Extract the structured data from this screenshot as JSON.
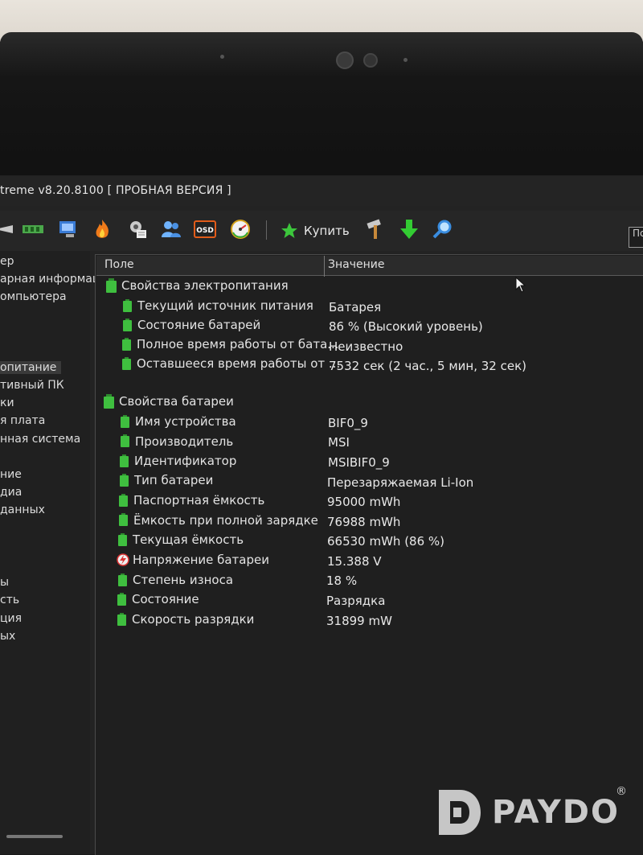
{
  "window": {
    "title": "treme v8.20.8100  [ ПРОБНАЯ ВЕРСИЯ ]"
  },
  "toolbar": {
    "buy_label": "Купить",
    "search_value": "Пс"
  },
  "tree": {
    "items": [
      "ер",
      "арная информац",
      "омпьютера",
      "",
      "",
      "",
      "опитание",
      "тивный ПК",
      "ки",
      "я плата",
      "нная система",
      "",
      "ние",
      "диа",
      "данных",
      "",
      "",
      "ы",
      "сть",
      "ция",
      "ых"
    ],
    "selected_index": 6
  },
  "grid": {
    "col_field": "Поле",
    "col_value": "Значение",
    "groups": [
      {
        "title": "Свойства электропитания",
        "rows": [
          {
            "label": "Текущий источник питания",
            "value": "Батарея"
          },
          {
            "label": "Состояние батарей",
            "value": "86 % (Высокий уровень)"
          },
          {
            "label": "Полное время работы от бата...",
            "value": "Неизвестно"
          },
          {
            "label": "Оставшееся время работы от ...",
            "value": "7532 сек (2 час., 5 мин, 32 сек)"
          }
        ]
      },
      {
        "title": "Свойства батареи",
        "rows": [
          {
            "label": "Имя устройства",
            "value": "BIF0_9"
          },
          {
            "label": "Производитель",
            "value": "MSI"
          },
          {
            "label": "Идентификатор",
            "value": "MSIBIF0_9"
          },
          {
            "label": "Тип батареи",
            "value": "Перезаряжаемая Li-Ion"
          },
          {
            "label": "Паспортная ёмкость",
            "value": "95000 mWh"
          },
          {
            "label": "Ёмкость при полной зарядке",
            "value": "76988 mWh"
          },
          {
            "label": "Текущая ёмкость",
            "value": "66530 mWh  (86 %)"
          },
          {
            "label": "Напряжение батареи",
            "value": "15.388 V"
          },
          {
            "label": "Степень износа",
            "value": "18 %"
          },
          {
            "label": "Состояние",
            "value": "Разрядка"
          },
          {
            "label": "Скорость разрядки",
            "value": "31899 mW"
          }
        ]
      }
    ]
  },
  "watermark": {
    "brand": "PAYDO",
    "reg": "®"
  },
  "colors": {
    "battery_green": "#3fbf3f",
    "screen_bg": "#1f1f1f",
    "text": "#e6e6e6"
  }
}
